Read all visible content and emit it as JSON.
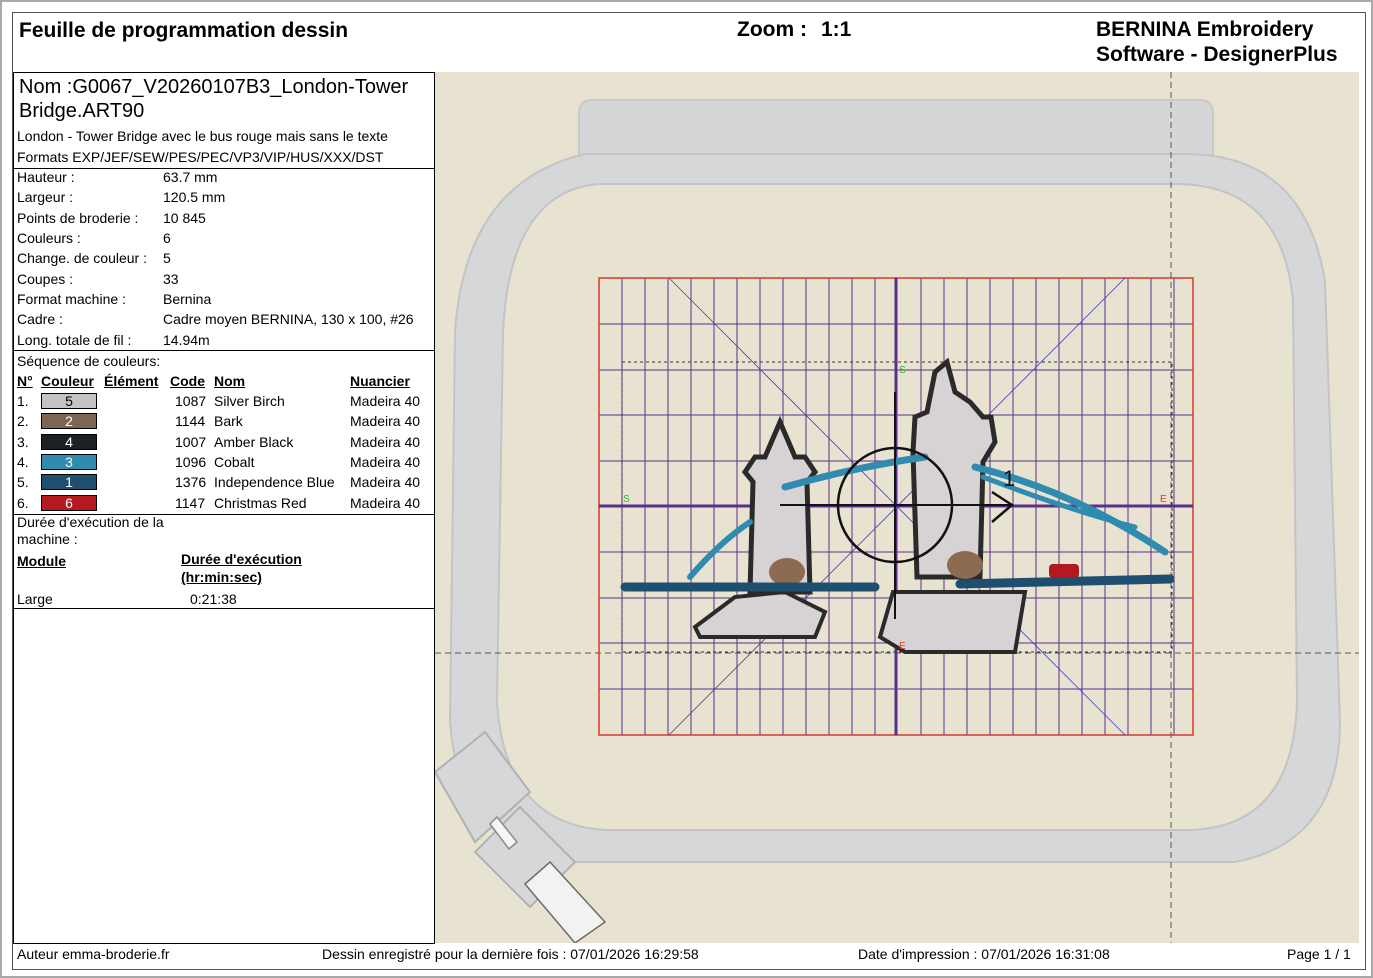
{
  "header": {
    "title": "Feuille de programmation dessin",
    "zoom_label": "Zoom :",
    "zoom_value": "1:1",
    "brand_line1": "BERNINA Embroidery",
    "brand_line2": "Software - DesignerPlus"
  },
  "design": {
    "name": "Nom :G0067_V20260107B3_London-Tower Bridge.ART90",
    "description": "London - Tower Bridge avec le bus rouge mais sans le texte",
    "formats": "Formats EXP/JEF/SEW/PES/PEC/VP3/VIP/HUS/XXX/DST"
  },
  "properties": [
    {
      "label": "Hauteur :",
      "value": "63.7 mm"
    },
    {
      "label": "Largeur :",
      "value": "120.5 mm"
    },
    {
      "label": "Points de broderie :",
      "value": "10 845"
    },
    {
      "label": "Couleurs :",
      "value": "6"
    },
    {
      "label": "Change. de couleur :",
      "value": "5"
    },
    {
      "label": "Coupes :",
      "value": "33"
    },
    {
      "label": "Format machine :",
      "value": "Bernina"
    },
    {
      "label": "Cadre :",
      "value": "Cadre moyen BERNINA, 130 x 100, #26"
    },
    {
      "label": "Long. totale de fil :",
      "value": "14.94m"
    }
  ],
  "color_sequence": {
    "title": "Séquence de couleurs:",
    "headers": {
      "no": "N°",
      "color": "Couleur",
      "element": "Élément",
      "code": "Code",
      "name": "Nom",
      "chart": "Nuancier"
    },
    "rows": [
      {
        "no": "1.",
        "swatch_label": "5",
        "swatch_color": "#c3c3c3",
        "code": "1087",
        "name": "Silver Birch",
        "chart": "Madeira 40"
      },
      {
        "no": "2.",
        "swatch_label": "2",
        "swatch_color": "#7b6654",
        "code": "1144",
        "name": "Bark",
        "chart": "Madeira 40"
      },
      {
        "no": "3.",
        "swatch_label": "4",
        "swatch_color": "#1e2124",
        "code": "1007",
        "name": "Amber Black",
        "chart": "Madeira 40"
      },
      {
        "no": "4.",
        "swatch_label": "3",
        "swatch_color": "#2f8bb0",
        "code": "1096",
        "name": "Cobalt",
        "chart": "Madeira 40"
      },
      {
        "no": "5.",
        "swatch_label": "1",
        "swatch_color": "#1f4e6e",
        "code": "1376",
        "name": "Independence Blue",
        "chart": "Madeira 40"
      },
      {
        "no": "6.",
        "swatch_label": "6",
        "swatch_color": "#b3191f",
        "code": "1147",
        "name": "Christmas Red",
        "chart": "Madeira 40"
      }
    ]
  },
  "runtime": {
    "title_line1": "Durée d'exécution de la",
    "title_line2": "machine :",
    "module_header": "Module",
    "duration_header_1": "Durée d'exécution",
    "duration_header_2": "(hr:min:sec)",
    "module": "Large",
    "duration": "0:21:38"
  },
  "canvas": {
    "start_marker": "S",
    "end_marker": "E",
    "sequence_label": "1"
  },
  "footer": {
    "author": "Auteur emma-broderie.fr",
    "saved": "Dessin enregistré pour la dernière fois : 07/01/2026 16:29:58",
    "printed": "Date d'impression : 07/01/2026 16:31:08",
    "page": "Page 1 / 1"
  }
}
